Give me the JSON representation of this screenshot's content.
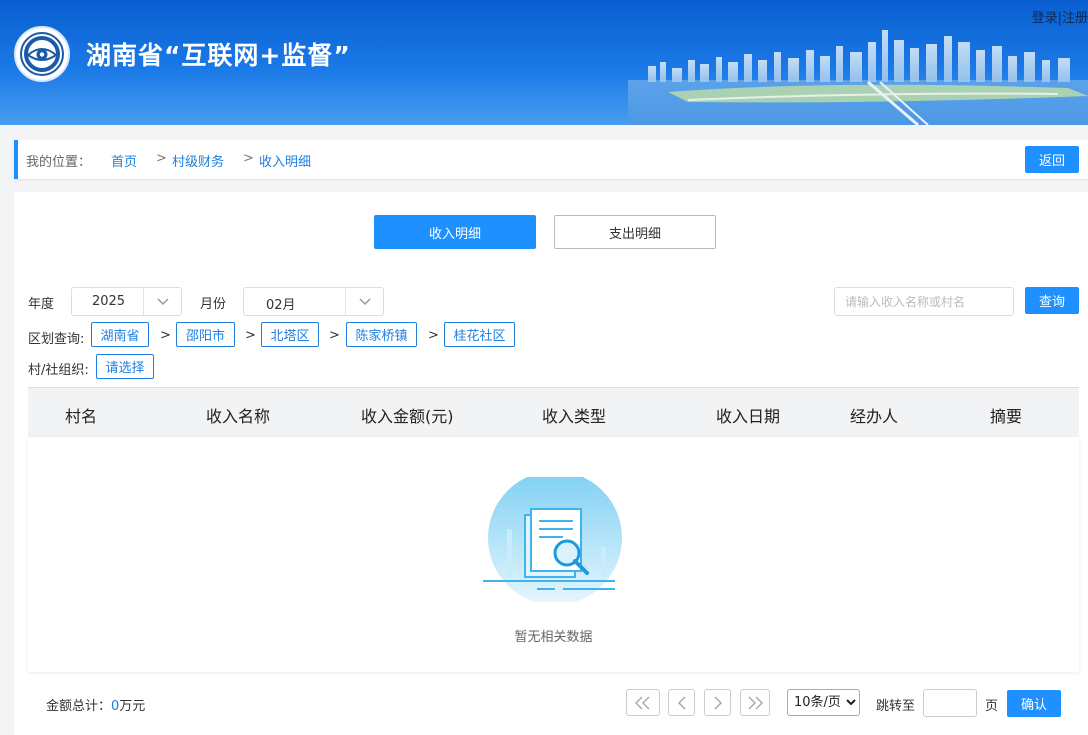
{
  "header": {
    "title": "湖南省“互联网+监督”",
    "login": "登录",
    "divider": "|",
    "register": "注册"
  },
  "breadcrumb": {
    "label": "我的位置：",
    "items": [
      "首页",
      "村级财务",
      "收入明细"
    ],
    "separator": ">",
    "back": "返回"
  },
  "tabs": {
    "income": "收入明细",
    "expense": "支出明细"
  },
  "filters": {
    "year_label": "年度",
    "year_value": "2025",
    "month_label": "月份",
    "month_value": "02月",
    "search_placeholder": "请输入收入名称或村名",
    "query": "查询",
    "region_label": "区划查询:",
    "regions": [
      "湖南省",
      "邵阳市",
      "北塔区",
      "陈家桥镇",
      "桂花社区"
    ],
    "region_sep": ">",
    "org_label": "村/社组织:",
    "org_select": "请选择"
  },
  "table": {
    "columns": [
      "村名",
      "收入名称",
      "收入金额(元)",
      "收入类型",
      "收入日期",
      "经办人",
      "摘要"
    ],
    "rows": [],
    "empty_text": "暂无相关数据"
  },
  "footer": {
    "total_label": "金额总计：",
    "total_value": "0",
    "total_unit": "万元",
    "page_size": "10条/页",
    "jump_label": "跳转至",
    "page_unit": "页",
    "confirm": "确认"
  },
  "colors": {
    "primary": "#1e90ff",
    "link": "#1e7fe0",
    "header_top": "#0a5fd0"
  }
}
